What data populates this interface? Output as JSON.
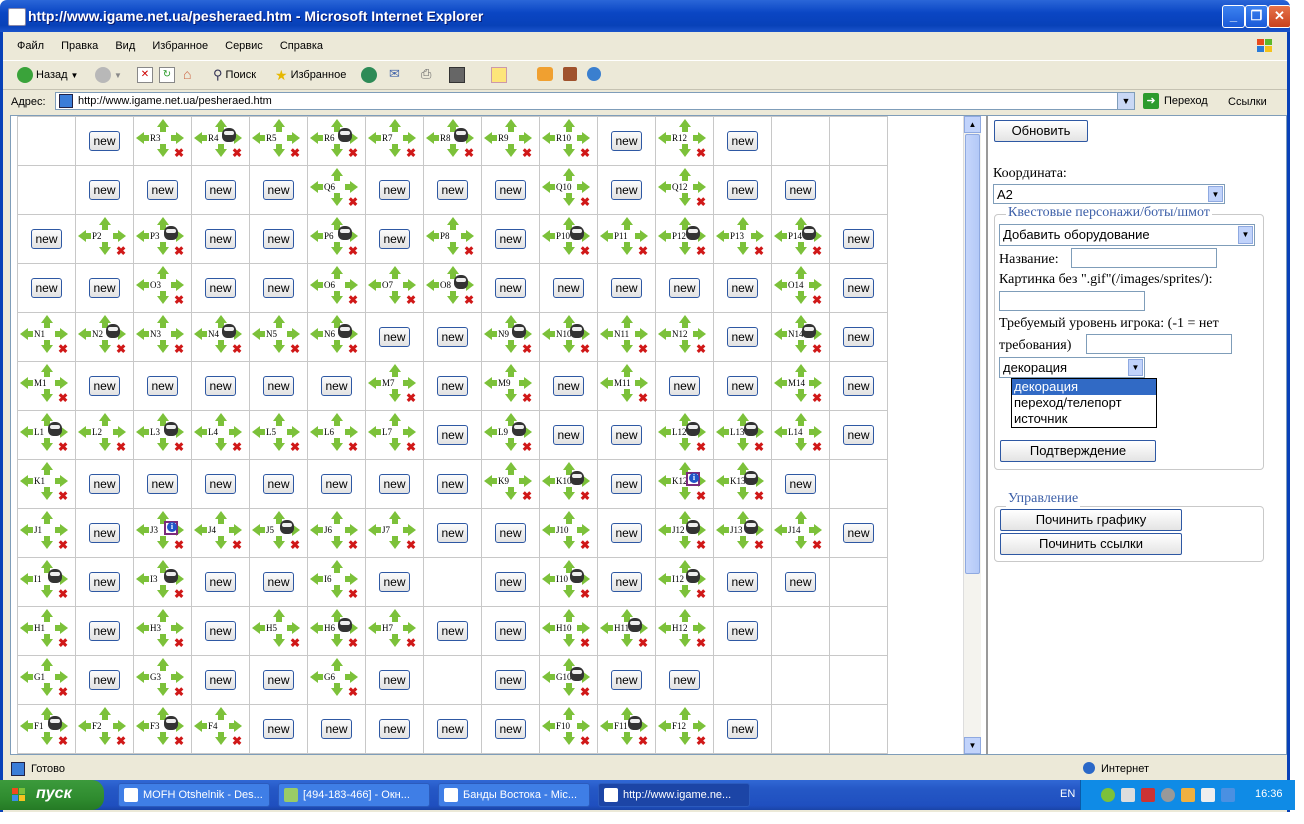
{
  "window": {
    "title": "http://www.igame.net.ua/pesheraed.htm - Microsoft Internet Explorer",
    "minimize": "_",
    "maximize": "❐",
    "close": "✕"
  },
  "menu": [
    "Файл",
    "Правка",
    "Вид",
    "Избранное",
    "Сервис",
    "Справка"
  ],
  "toolbar": {
    "back": "Назад",
    "search": "Поиск",
    "favorites": "Избранное"
  },
  "address": {
    "label": "Адрес:",
    "url": "http://www.igame.net.ua/pesheraed.htm",
    "go": "Переход",
    "links": "Ссылки"
  },
  "grid": {
    "new_label": "new",
    "rows": [
      [
        "",
        "new",
        "A:R3",
        "M:R4",
        "A:R5",
        "M:R6",
        "A:R7",
        "M:R8",
        "A:R9",
        "A:R10",
        "new",
        "A:R12",
        "new",
        "",
        ""
      ],
      [
        "",
        "new",
        "new",
        "new",
        "new",
        "A:Q6",
        "new",
        "new",
        "new",
        "A:Q10",
        "new",
        "A:Q12",
        "new",
        "new",
        ""
      ],
      [
        "new",
        "A:P2",
        "M:P3",
        "new",
        "new",
        "M:P6",
        "new",
        "A:P8",
        "new",
        "M:P10",
        "A:P11",
        "M:P12",
        "A:P13",
        "M:P14",
        "new"
      ],
      [
        "new",
        "new",
        "A:O3",
        "new",
        "new",
        "A:O6",
        "A:O7",
        "M:O8",
        "new",
        "new",
        "new",
        "new",
        "new",
        "A:O14",
        "new"
      ],
      [
        "A:N1",
        "M:N2",
        "A:N3",
        "M:N4",
        "A:N5",
        "M:N6",
        "new",
        "new",
        "M:N9",
        "M:N10",
        "A:N11",
        "A:N12",
        "new",
        "M:N14",
        "new"
      ],
      [
        "A:M1",
        "new",
        "new",
        "new",
        "new",
        "new",
        "A:M7",
        "new",
        "A:M9",
        "new",
        "A:M11",
        "new",
        "new",
        "A:M14",
        "new"
      ],
      [
        "M:L1",
        "A:L2",
        "M:L3",
        "A:L4",
        "A:L5",
        "A:L6",
        "A:L7",
        "new",
        "M:L9",
        "new",
        "new",
        "M:L12",
        "M:L13",
        "A:L14",
        "new"
      ],
      [
        "A:K1",
        "new",
        "new",
        "new",
        "new",
        "new",
        "new",
        "new",
        "A:K9",
        "M:K10",
        "new",
        "I:K12",
        "M:K13",
        "new",
        ""
      ],
      [
        "A:J1",
        "new",
        "I:J3",
        "A:J4",
        "M:J5",
        "A:J6",
        "A:J7",
        "new",
        "new",
        "A:J10",
        "new",
        "M:J12",
        "M:J13",
        "A:J14",
        "new"
      ],
      [
        "M:I1",
        "new",
        "M:I3",
        "new",
        "new",
        "A:I6",
        "new",
        "",
        "new",
        "M:I10",
        "new",
        "M:I12",
        "new",
        "new",
        ""
      ],
      [
        "A:H1",
        "new",
        "A:H3",
        "new",
        "A:H5",
        "M:H6",
        "A:H7",
        "new",
        "new",
        "A:H10",
        "M:H11",
        "A:H12",
        "new",
        "",
        ""
      ],
      [
        "A:G1",
        "new",
        "A:G3",
        "new",
        "new",
        "A:G6",
        "new",
        "",
        "new",
        "M:G10",
        "new",
        "new",
        "",
        "",
        ""
      ],
      [
        "M:F1",
        "A:F2",
        "M:F3",
        "A:F4",
        "new",
        "new",
        "new",
        "new",
        "new",
        "A:F10",
        "M:F11",
        "A:F12",
        "new",
        "",
        ""
      ]
    ]
  },
  "panel": {
    "refresh": "Обновить",
    "coord_label": "Координата:",
    "coord_value": "A2",
    "quest_legend": "Квестовые персонажи/боты/шмот",
    "add_select": "Добавить оборудование",
    "name_label": "Название:",
    "image_label": "Картинка без \".gif\"(/images/sprites/):",
    "level_label_1": "Требуемый уровень игрока: (-1 = нет",
    "level_label_2": "требования)",
    "type_value": "декорация",
    "type_options": [
      "декорация",
      "переход/телепорт",
      "источник"
    ],
    "confirm": "Подтверждение",
    "manage_legend": "Управление",
    "fix_graphics": "Починить графику",
    "fix_links": "Починить ссылки"
  },
  "status": {
    "left": "Готово",
    "right": "Интернет"
  },
  "taskbar": {
    "start": "пуск",
    "tasks": [
      "MOFH Otshelnik - Des...",
      "[494-183-466] - Окн...",
      "Банды Востока - Mic...",
      "http://www.igame.ne..."
    ],
    "lang": "EN",
    "clock": "16:36"
  }
}
